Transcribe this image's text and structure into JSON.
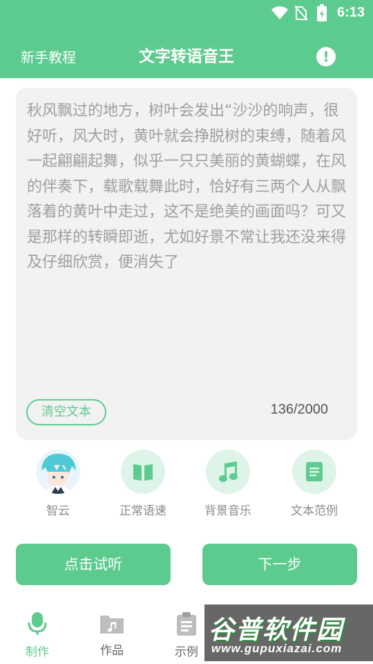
{
  "status_bar": {
    "time": "6:13"
  },
  "header": {
    "tutorial_label": "新手教程",
    "title": "文字转语音王",
    "info_icon": "exclamation-circle-icon"
  },
  "editor": {
    "text": "秋风飘过的地方，树叶会发出“沙沙的响声，很好听，风大时，黄叶就会挣脱树的束缚，随着风一起翩翩起舞，似乎一只只美丽的黄蝴蝶，在风的伴奏下，载歌载舞此时，恰好有三两个人从飘落着的黄叶中走过，这不是绝美的画面吗？可又是那样的转瞬即逝，尤如好景不常让我还没来得及仔细欣赏，便消失了",
    "clear_label": "清空文本",
    "char_count": "136/2000"
  },
  "options": [
    {
      "label": "智云",
      "icon": "voice-avatar"
    },
    {
      "label": "正常语速",
      "icon": "book-icon"
    },
    {
      "label": "背景音乐",
      "icon": "music-note-icon"
    },
    {
      "label": "文本范例",
      "icon": "document-icon"
    }
  ],
  "actions": {
    "preview_label": "点击试听",
    "next_label": "下一步"
  },
  "nav": [
    {
      "label": "制作",
      "icon": "microphone-icon",
      "active": true
    },
    {
      "label": "作品",
      "icon": "folder-music-icon",
      "active": false
    },
    {
      "label": "示例",
      "icon": "clipboard-icon",
      "active": false
    }
  ],
  "watermark": {
    "title": "谷普软件园",
    "url": "www.gupuxiazai.com"
  },
  "colors": {
    "accent": "#5dcb8f",
    "accent_light": "#def4e8",
    "card_bg": "#f2f2f2"
  }
}
